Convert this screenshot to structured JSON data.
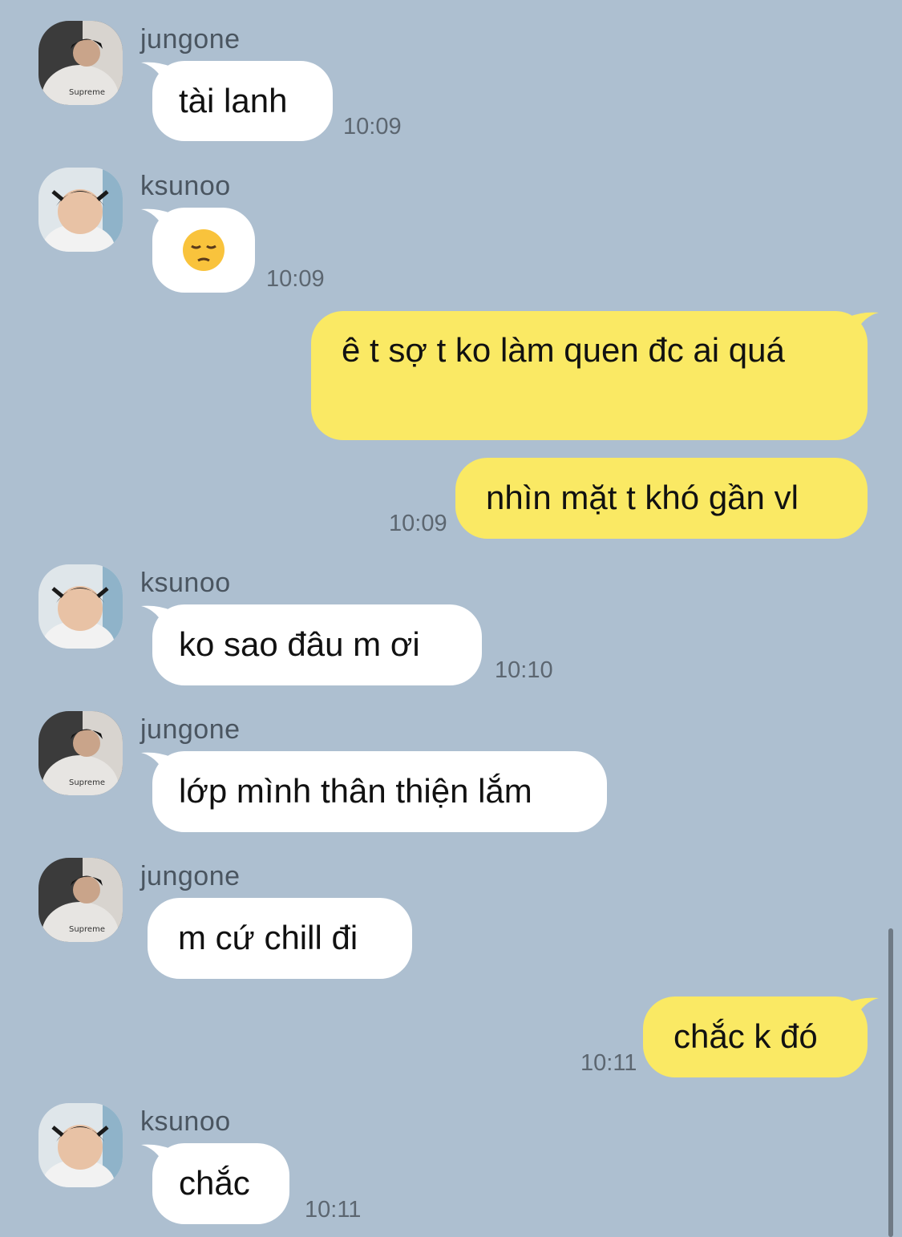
{
  "colors": {
    "background": "#adbfd0",
    "incoming_bubble": "#ffffff",
    "outgoing_bubble": "#fae964",
    "timestamp": "#5c6670"
  },
  "messages": [
    {
      "direction": "incoming",
      "sender": "jungone",
      "avatar": "avatar-jungone",
      "text": "tài lanh",
      "time": "10:09"
    },
    {
      "direction": "incoming",
      "sender": "ksunoo",
      "avatar": "avatar-ksunoo",
      "text": "😔",
      "time": "10:09"
    },
    {
      "direction": "outgoing",
      "text": "ê t sợ t ko làm quen đc ai quá"
    },
    {
      "direction": "outgoing",
      "text": "nhìn mặt t khó gần vl",
      "time": "10:09"
    },
    {
      "direction": "incoming",
      "sender": "ksunoo",
      "avatar": "avatar-ksunoo",
      "text": "ko sao đâu m ơi",
      "time": "10:10"
    },
    {
      "direction": "incoming",
      "sender": "jungone",
      "avatar": "avatar-jungone",
      "text": "lớp mình thân thiện lắm"
    },
    {
      "direction": "incoming",
      "sender": "jungone",
      "avatar": "avatar-jungone",
      "text": "m cứ chill đi"
    },
    {
      "direction": "outgoing",
      "text": "chắc k đó",
      "time": "10:11"
    },
    {
      "direction": "incoming",
      "sender": "ksunoo",
      "avatar": "avatar-ksunoo",
      "text": "chắc",
      "time": "10:11"
    }
  ]
}
